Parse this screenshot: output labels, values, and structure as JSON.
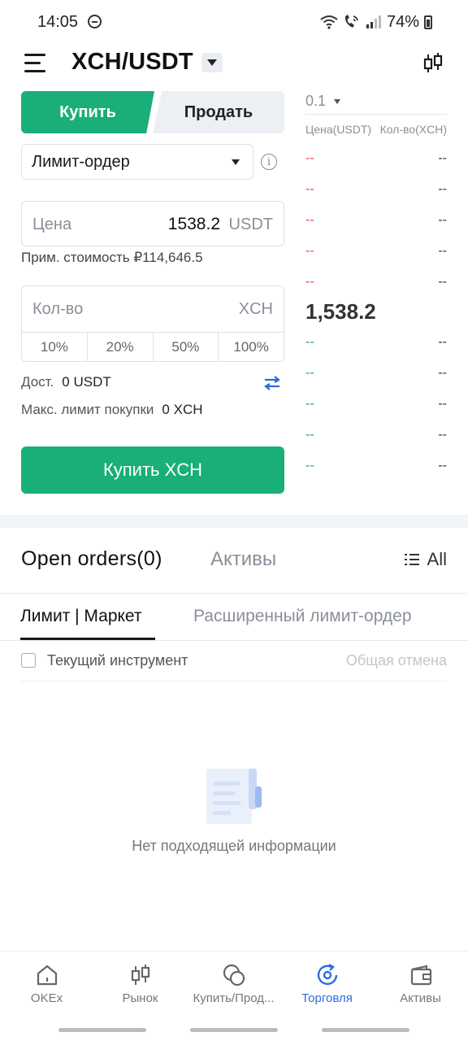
{
  "status_bar": {
    "time": "14:05",
    "battery": "74%"
  },
  "header": {
    "pair": "XCH/USDT"
  },
  "trade": {
    "tab_buy": "Купить",
    "tab_sell": "Продать",
    "order_type": "Лимит-ордер",
    "price_label": "Цена",
    "price_value": "1538.2",
    "price_unit": "USDT",
    "approx_cost": "Прим. стоимость ₽114,646.5",
    "qty_label": "Кол-во",
    "qty_unit": "XCH",
    "percents": [
      "10%",
      "20%",
      "50%",
      "100%"
    ],
    "available_label": "Дост.",
    "available_value": "0 USDT",
    "max_buy_label": "Макс. лимит покупки",
    "max_buy_value": "0 XCH",
    "buy_button": "Купить XCH",
    "colors": {
      "buy": "#1aaf78",
      "ask": "#e04a4a",
      "bid": "#17a87a",
      "active_nav": "#2f6be0"
    }
  },
  "order_book": {
    "depth": "0.1",
    "price_header": "Цена(USDT)",
    "qty_header": "Кол-во(XCH)",
    "asks": [
      {
        "price": "--",
        "qty": "--"
      },
      {
        "price": "--",
        "qty": "--"
      },
      {
        "price": "--",
        "qty": "--"
      },
      {
        "price": "--",
        "qty": "--"
      },
      {
        "price": "--",
        "qty": "--"
      }
    ],
    "last_price": "1,538.2",
    "bids": [
      {
        "price": "--",
        "qty": "--"
      },
      {
        "price": "--",
        "qty": "--"
      },
      {
        "price": "--",
        "qty": "--"
      },
      {
        "price": "--",
        "qty": "--"
      },
      {
        "price": "--",
        "qty": "--"
      }
    ]
  },
  "orders": {
    "title": "Open orders(0)",
    "assets_tab": "Активы",
    "all_label": "All",
    "subtab_limit": "Лимит | Маркет",
    "subtab_advanced": "Расширенный лимит-ордер",
    "current_instrument": "Текущий инструмент",
    "cancel_all": "Общая отмена",
    "empty_text": "Нет подходящей информации"
  },
  "bottom_nav": [
    {
      "label": "OKEx",
      "icon": "home-icon"
    },
    {
      "label": "Рынок",
      "icon": "candlestick-icon"
    },
    {
      "label": "Купить/Прод...",
      "icon": "coins-icon"
    },
    {
      "label": "Торговля",
      "icon": "trade-icon",
      "active": true
    },
    {
      "label": "Активы",
      "icon": "wallet-icon"
    }
  ]
}
